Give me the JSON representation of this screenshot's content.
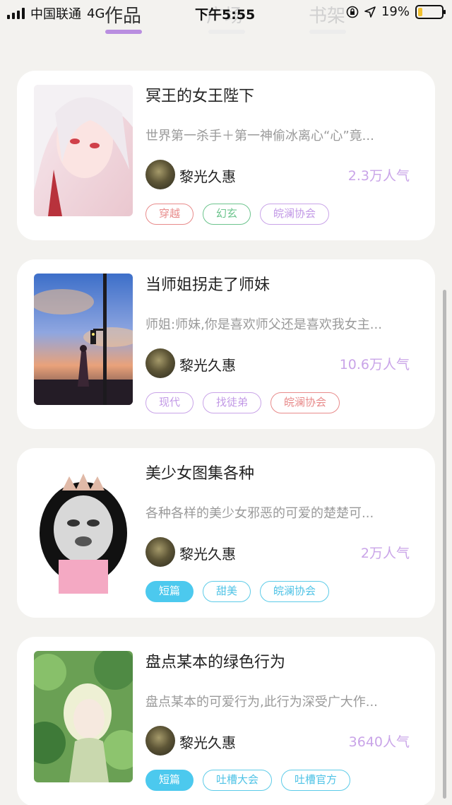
{
  "status_bar": {
    "carrier": "中国联通",
    "network": "4G",
    "time": "下午5:55",
    "battery_text": "19%",
    "battery_level": 0.19
  },
  "tabs": [
    {
      "label": "作品",
      "active": true
    },
    {
      "label": "广场",
      "active": false
    },
    {
      "label": "书架",
      "active": false
    }
  ],
  "works": [
    {
      "title": "冥王的女王陛下",
      "description": "世界第一杀手＋第一神偷冰离心“心”竟...",
      "author": "黎光久惠",
      "popularity": "2.3万人气",
      "tags": [
        {
          "label": "穿越",
          "style": "red"
        },
        {
          "label": "幻玄",
          "style": "green"
        },
        {
          "label": "皖澜协会",
          "style": "purple"
        }
      ]
    },
    {
      "title": "当师姐拐走了师妹",
      "description": "师姐:师妹,你是喜欢师父还是喜欢我女主...",
      "author": "黎光久惠",
      "popularity": "10.6万人气",
      "tags": [
        {
          "label": "现代",
          "style": "purple"
        },
        {
          "label": "找徒弟",
          "style": "purple"
        },
        {
          "label": "皖澜协会",
          "style": "red"
        }
      ]
    },
    {
      "title": "美少女图集各种",
      "description": "各种各样的美少女邪恶的可爱的楚楚可...",
      "author": "黎光久惠",
      "popularity": "2万人气",
      "tags": [
        {
          "label": "短篇",
          "style": "cyan-fill"
        },
        {
          "label": "甜美",
          "style": "cyan"
        },
        {
          "label": "皖澜协会",
          "style": "cyan"
        }
      ]
    },
    {
      "title": "盘点某本的绿色行为",
      "description": "盘点某本的可爱行为,此行为深受广大作...",
      "author": "黎光久惠",
      "popularity": "3640人气",
      "tags": [
        {
          "label": "短篇",
          "style": "cyan-fill"
        },
        {
          "label": "吐槽大会",
          "style": "cyan"
        },
        {
          "label": "吐槽官方",
          "style": "cyan"
        }
      ]
    }
  ],
  "colors": {
    "accent_purple": "#b98ee0",
    "popularity": "#c9a4e8",
    "background": "#f3f2ef"
  }
}
